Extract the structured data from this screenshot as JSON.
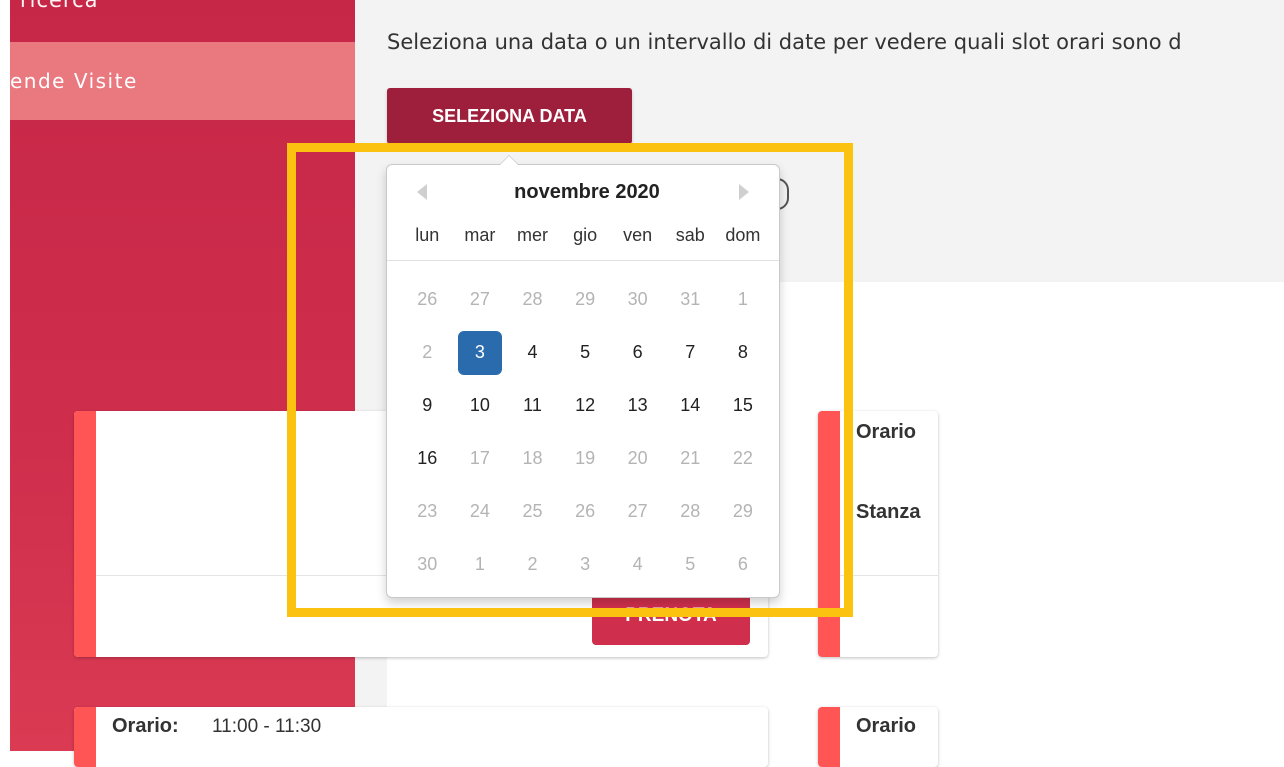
{
  "sidebar": {
    "partial_top_label": "ricerca",
    "active_item_label": "ende Visite"
  },
  "main": {
    "intro_text": "Seleziona una data o un intervallo di date per vedere quali slot orari sono d",
    "select_date_label": "SELEZIONA DATA"
  },
  "cards": {
    "card1": {
      "book_label": "PRENOTA"
    },
    "card2": {
      "label_time": "Orario",
      "label_room": "Stanza"
    },
    "card3": {
      "label_time": "Orario:",
      "time_value": "11:00 - 11:30"
    },
    "card4": {
      "label_time": "Orario"
    }
  },
  "datepicker": {
    "month_title": "novembre 2020",
    "weekdays": [
      "lun",
      "mar",
      "mer",
      "gio",
      "ven",
      "sab",
      "dom"
    ],
    "days": [
      {
        "d": "26",
        "muted": true
      },
      {
        "d": "27",
        "muted": true
      },
      {
        "d": "28",
        "muted": true
      },
      {
        "d": "29",
        "muted": true
      },
      {
        "d": "30",
        "muted": true
      },
      {
        "d": "31",
        "muted": true
      },
      {
        "d": "1",
        "muted": true
      },
      {
        "d": "2",
        "muted": true
      },
      {
        "d": "3",
        "selected": true
      },
      {
        "d": "4"
      },
      {
        "d": "5"
      },
      {
        "d": "6"
      },
      {
        "d": "7"
      },
      {
        "d": "8"
      },
      {
        "d": "9"
      },
      {
        "d": "10"
      },
      {
        "d": "11"
      },
      {
        "d": "12"
      },
      {
        "d": "13"
      },
      {
        "d": "14"
      },
      {
        "d": "15"
      },
      {
        "d": "16"
      },
      {
        "d": "17",
        "muted": true
      },
      {
        "d": "18",
        "muted": true
      },
      {
        "d": "19",
        "muted": true
      },
      {
        "d": "20",
        "muted": true
      },
      {
        "d": "21",
        "muted": true
      },
      {
        "d": "22",
        "muted": true
      },
      {
        "d": "23",
        "muted": true
      },
      {
        "d": "24",
        "muted": true
      },
      {
        "d": "25",
        "muted": true
      },
      {
        "d": "26",
        "muted": true
      },
      {
        "d": "27",
        "muted": true
      },
      {
        "d": "28",
        "muted": true
      },
      {
        "d": "29",
        "muted": true
      },
      {
        "d": "30",
        "muted": true
      },
      {
        "d": "1",
        "muted": true
      },
      {
        "d": "2",
        "muted": true
      },
      {
        "d": "3",
        "muted": true
      },
      {
        "d": "4",
        "muted": true
      },
      {
        "d": "5",
        "muted": true
      },
      {
        "d": "6",
        "muted": true
      }
    ]
  },
  "colors": {
    "sidebar": "#c72747",
    "sidebar_active": "#e9787f",
    "primary_button": "#9e1f3c",
    "accent": "#ff5555",
    "selected_day": "#2a6bad",
    "highlight_box": "#fcc210"
  },
  "icons": {
    "prev": "chevron-left-icon",
    "next": "chevron-right-icon"
  }
}
